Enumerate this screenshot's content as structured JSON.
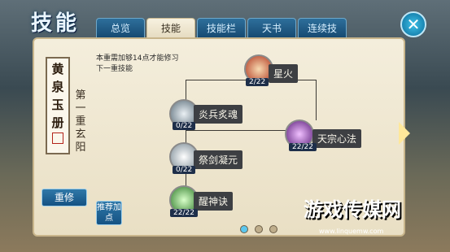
{
  "window": {
    "title": "技能"
  },
  "tabs": [
    {
      "label": "总览"
    },
    {
      "label": "技能",
      "active": true
    },
    {
      "label": "技能栏"
    },
    {
      "label": "天书"
    },
    {
      "label": "连续技"
    }
  ],
  "scroll": {
    "text": "黄泉玉册"
  },
  "realm": {
    "label": "第一重玄阳"
  },
  "note": {
    "text": "本重需加够14点才能修习下一重技能"
  },
  "buttons": {
    "reset": "重修",
    "recommend": "推荐加点"
  },
  "skills": [
    {
      "name": "星火",
      "level": "2/22"
    },
    {
      "name": "炎兵炙魂",
      "level": "0/22"
    },
    {
      "name": "天宗心法",
      "level": "22/22"
    },
    {
      "name": "祭剑凝元",
      "level": "0/22"
    },
    {
      "name": "醒神诀",
      "level": "22/22"
    }
  ],
  "pagination": {
    "total": 3,
    "current": 1
  },
  "watermark": {
    "text": "游戏传媒网",
    "url": "www.linquemw.com"
  },
  "colors": {
    "accent": "#2f78a8",
    "panel": "#f4eedc"
  }
}
